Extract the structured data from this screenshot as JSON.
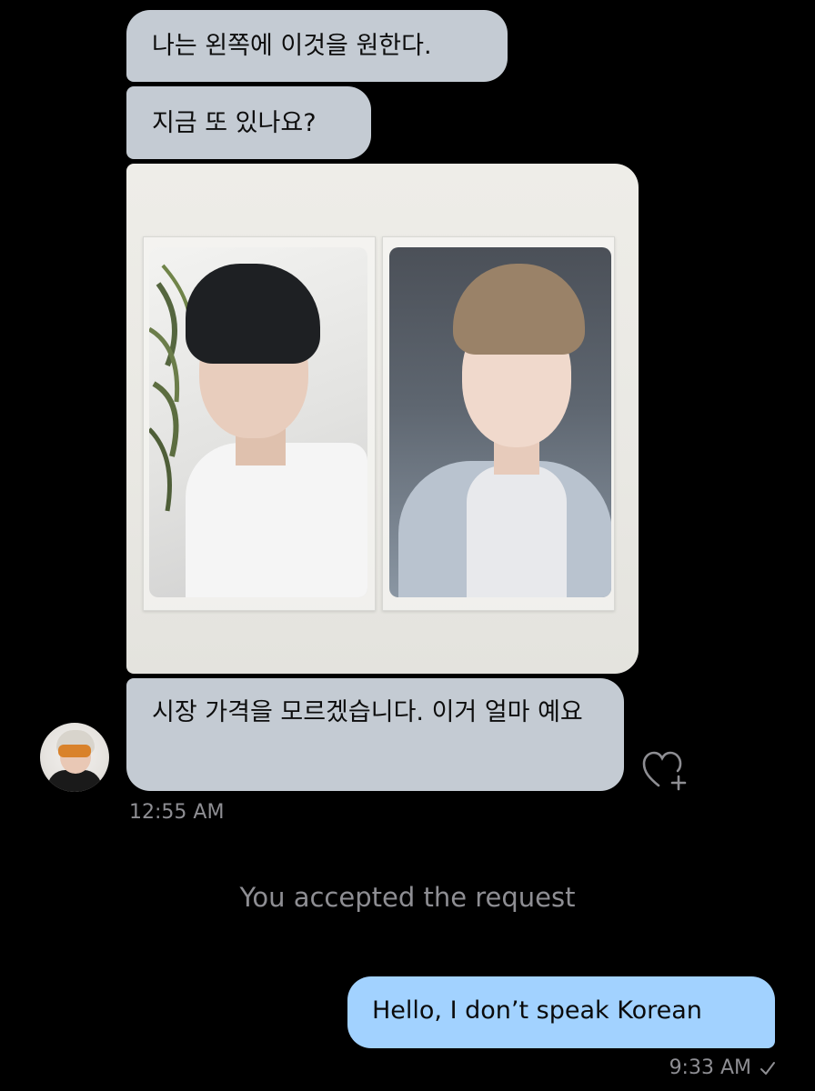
{
  "messages": {
    "incoming_1": "나는 왼쪽에 이것을 원한다.",
    "incoming_2": "지금 또 있나요?",
    "incoming_3": "시장 가격을 모르겠습니다. 이거 얼마 예요",
    "incoming_timestamp": "12:55 AM",
    "outgoing_1": "Hello, I don’t speak Korean",
    "outgoing_timestamp": "9:33 AM"
  },
  "system": {
    "accepted_notice": "You accepted the request"
  },
  "icons": {
    "react": "heart-plus-icon",
    "status": "checkmark-icon"
  },
  "colors": {
    "background": "#000000",
    "incoming_bubble": "#c4cbd3",
    "outgoing_bubble": "#a2d2ff",
    "meta_text": "#8e8e93"
  }
}
